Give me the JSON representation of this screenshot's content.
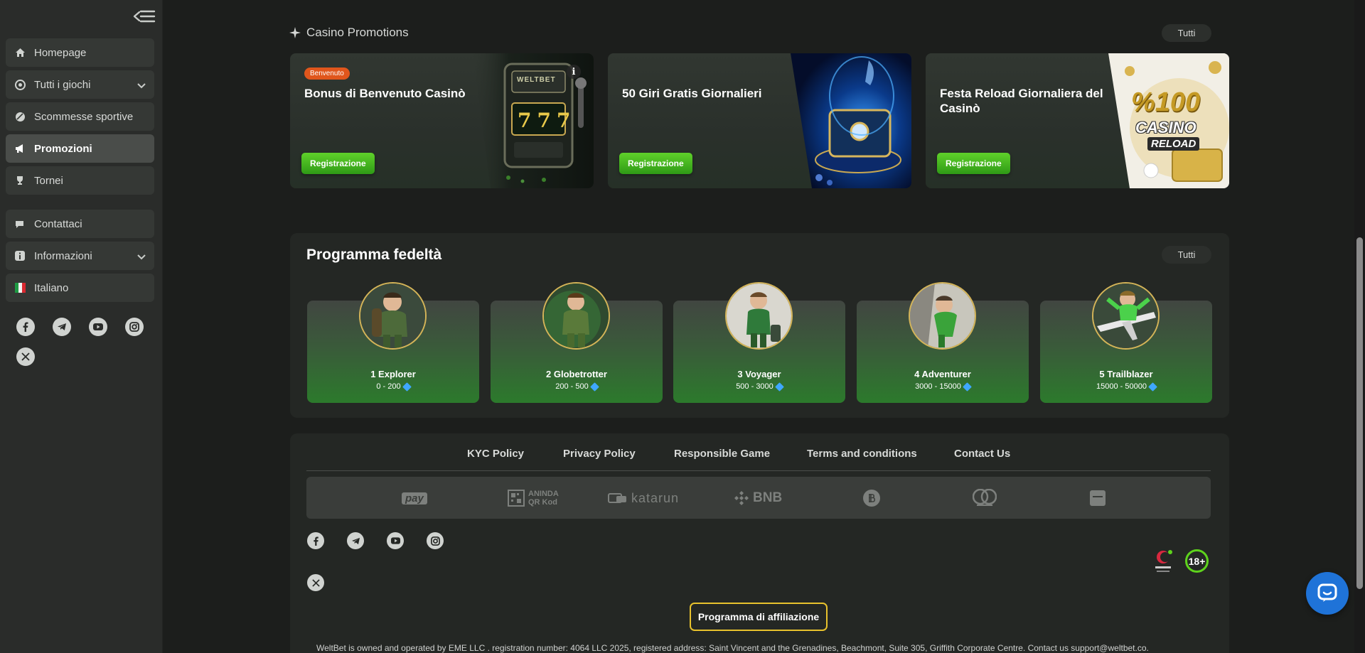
{
  "sidebar": {
    "items": [
      {
        "label": "Homepage",
        "icon": "home-icon"
      },
      {
        "label": "Tutti i giochi",
        "icon": "games-icon"
      },
      {
        "label": "Scommesse sportive",
        "icon": "sports-icon"
      },
      {
        "label": "Promozioni",
        "icon": "megaphone-icon"
      },
      {
        "label": "Tornei",
        "icon": "trophy-icon"
      },
      {
        "label": "Contattaci",
        "icon": "chat-icon"
      },
      {
        "label": "Informazioni",
        "icon": "info-icon"
      },
      {
        "label": "Italiano",
        "icon": "italy-flag-icon"
      }
    ]
  },
  "promotions": {
    "title": "Casino Promotions",
    "all_label": "Tutti",
    "cards": [
      {
        "title": "Bonus di Benvenuto Casinò",
        "button": "Registrazione",
        "badge": "Benvenuto",
        "art_text": "WELTBET",
        "slot_text": "777"
      },
      {
        "title": "50 Giri Gratis Giornalieri",
        "button": "Registrazione"
      },
      {
        "title": "Festa Reload Giornaliera del Casinò",
        "button": "Registrazione",
        "art_line1": "%100",
        "art_line2": "CASINO",
        "art_line3": "RELOAD"
      }
    ]
  },
  "loyalty": {
    "title": "Programma fedeltà",
    "all_label": "Tutti",
    "tiers": [
      {
        "name": "1 Explorer",
        "range": "0 - 200"
      },
      {
        "name": "2 Globetrotter",
        "range": "200 - 500"
      },
      {
        "name": "3 Voyager",
        "range": "500 - 3000"
      },
      {
        "name": "4 Adventurer",
        "range": "3000 - 15000"
      },
      {
        "name": "5 Trailblazer",
        "range": "15000 - 50000"
      }
    ]
  },
  "footer": {
    "links": [
      "KYC Policy",
      "Privacy Policy",
      "Responsible Game",
      "Terms and conditions",
      "Contact Us"
    ],
    "payments": [
      "pay",
      "ANINDA QR Kod",
      "katarun",
      "BNB"
    ],
    "affiliate_label": "Programma di affiliazione",
    "legal": "WeltBet is owned and operated by EME LLC . registration number: 4064 LLC 2025, registered address: Saint Vincent and the Grenadines, Beachmont, Suite 305, Griffith Corporate Centre. Contact us support@weltbet.co.",
    "age_label": "18+"
  },
  "colors": {
    "accent_green": "#4cc020",
    "badge_orange": "#e0561c",
    "affiliate_border": "#e8c22d",
    "chat_blue": "#1f73d8"
  }
}
